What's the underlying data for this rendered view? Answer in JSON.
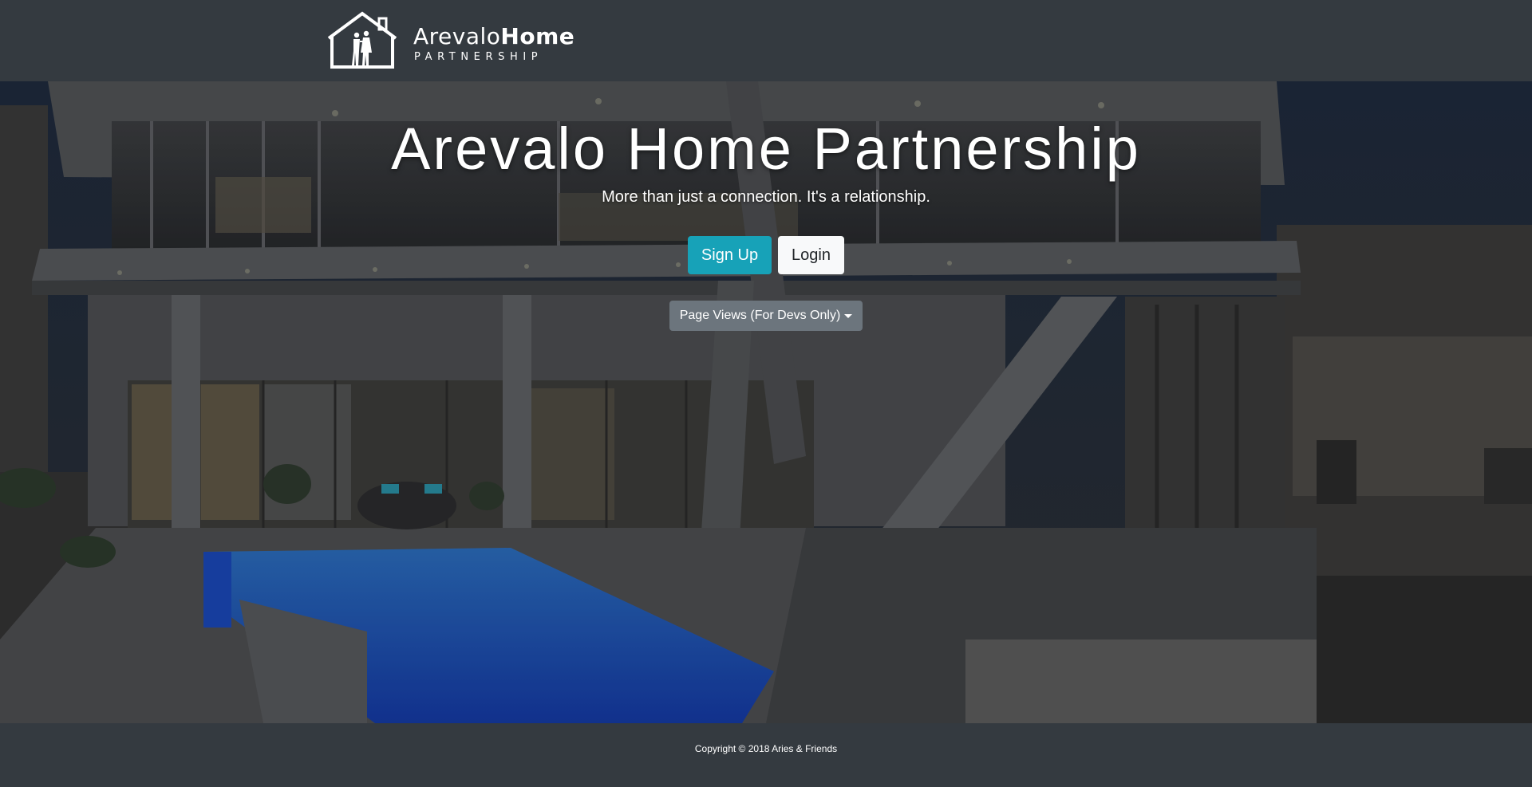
{
  "brand": {
    "name_light": "Arevalo",
    "name_bold": "Home",
    "subtitle": "PARTNERSHIP",
    "logo_icon": "house-with-couple-icon"
  },
  "hero": {
    "title": "Arevalo Home Partnership",
    "tagline": "More than just a connection. It's a relationship.",
    "background_image": "modern-house-with-pool-at-night",
    "signup_label": "Sign Up",
    "login_label": "Login",
    "dropdown_label": "Page Views (For Devs Only)"
  },
  "footer": {
    "copyright": "Copyright © 2018 Aries & Friends"
  },
  "colors": {
    "navbar_bg": "#343a40",
    "signup_bg": "#17a2b8",
    "login_bg": "#f8f9fa",
    "dropdown_bg": "#6c757d"
  }
}
